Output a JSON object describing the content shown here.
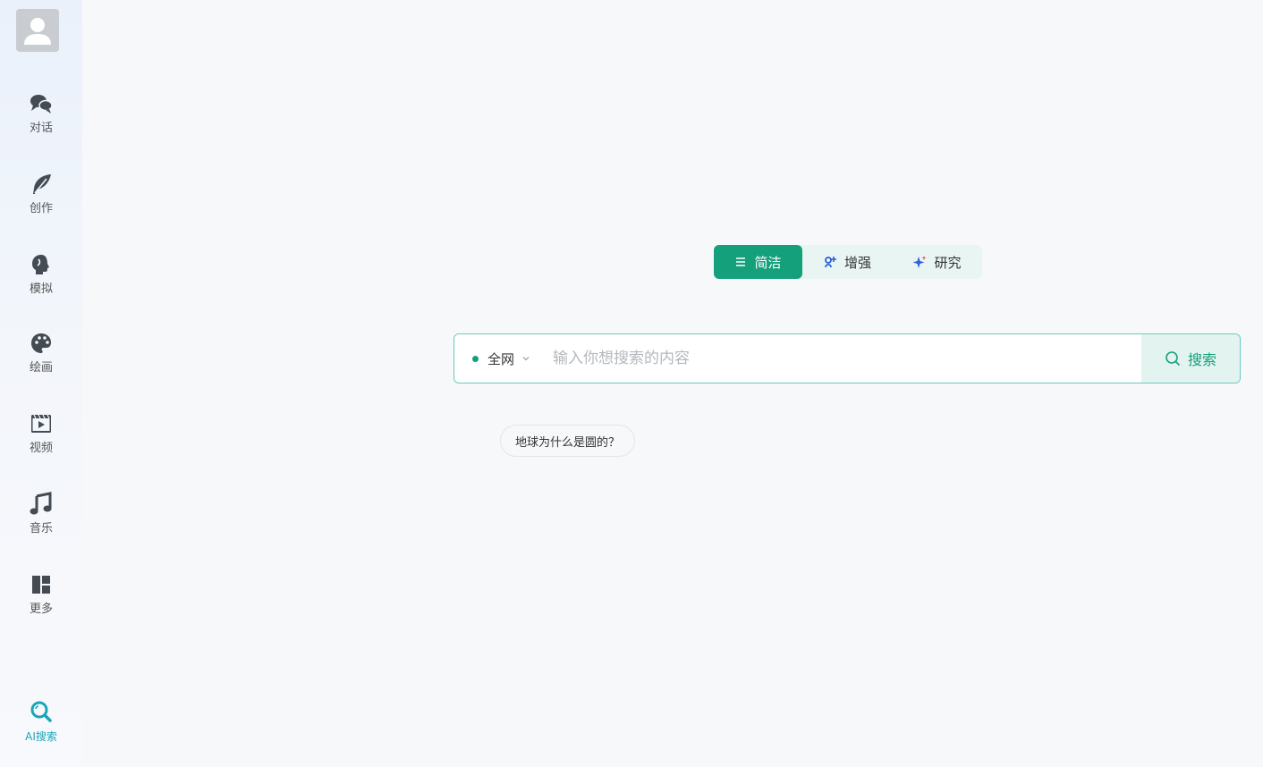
{
  "sidebar": {
    "items": [
      {
        "label": "对话",
        "icon": "chat-bubbles-icon"
      },
      {
        "label": "创作",
        "icon": "feather-icon"
      },
      {
        "label": "模拟",
        "icon": "head-profile-icon"
      },
      {
        "label": "绘画",
        "icon": "palette-icon"
      },
      {
        "label": "视频",
        "icon": "video-clapper-icon"
      },
      {
        "label": "音乐",
        "icon": "music-note-icon"
      },
      {
        "label": "更多",
        "icon": "grid-layout-icon"
      }
    ],
    "active_item": {
      "label": "AI搜索",
      "icon": "search-magnifier-icon"
    }
  },
  "modes": [
    {
      "label": "简洁",
      "icon": "list-icon",
      "selected": true
    },
    {
      "label": "增强",
      "icon": "enhance-icon",
      "selected": false
    },
    {
      "label": "研究",
      "icon": "sparkle-icon",
      "selected": false
    }
  ],
  "search": {
    "scope": "全网",
    "placeholder": "输入你想搜索的内容",
    "value": "",
    "button_label": "搜索"
  },
  "suggestions": [
    "地球为什么是圆的？"
  ],
  "colors": {
    "accent": "#15a07c",
    "active_nav": "#1aa6b8",
    "icon": "#444b52"
  }
}
